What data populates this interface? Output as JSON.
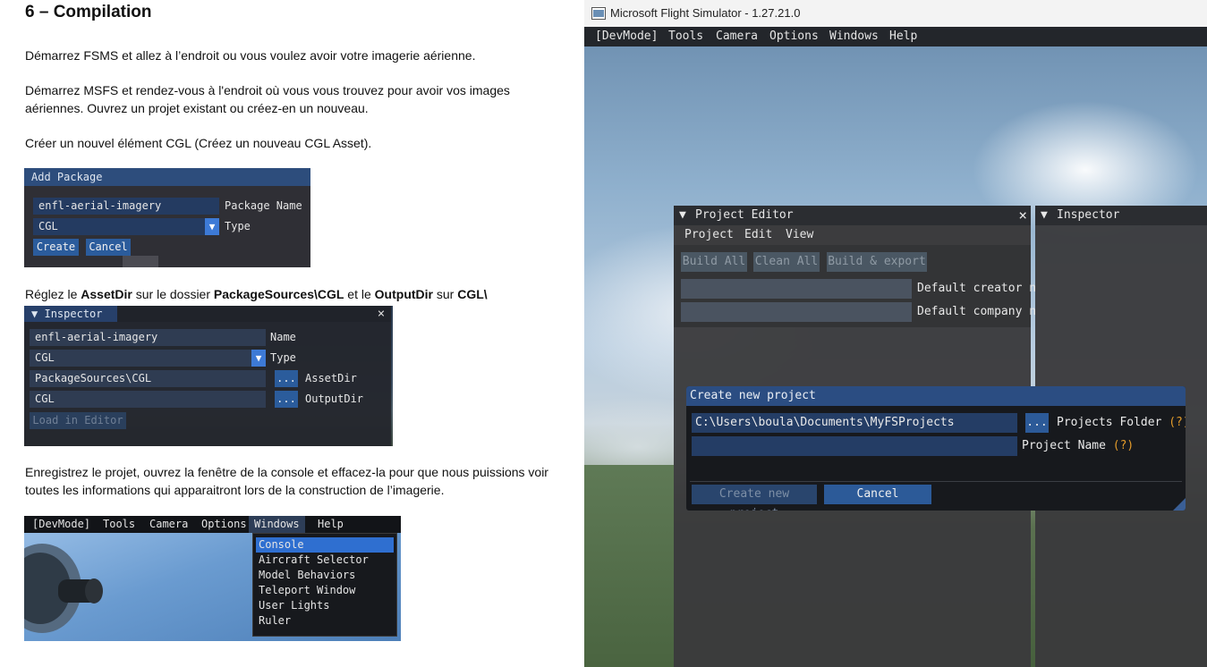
{
  "doc": {
    "heading": "6 – Compilation",
    "para1": "Démarrez FSMS et allez à l’endroit ou vous voulez avoir votre imagerie aérienne.",
    "para2_line1": "Démarrez MSFS et rendez-vous à l'endroit où vous vous trouvez pour avoir vos images",
    "para2_line2": "aériennes. Ouvrez un projet existant ou créez-en un nouveau.",
    "para3": "Créer un nouvel élément CGL (Créez un nouveau CGL Asset).",
    "para4": {
      "t1": "Réglez le ",
      "b1": "AssetDir",
      "t2": " sur le dossier ",
      "b2": "PackageSources\\CGL",
      "t3": " et le ",
      "b3": "OutputDir",
      "t4": " sur ",
      "b4": "CGL\\"
    },
    "para5_line1": "Enregistrez le projet, ouvrez la fenêtre de la console et effacez-la pour que nous puissions voir",
    "para5_line2": "toutes les informations qui apparaitront lors de la construction de l’imagerie."
  },
  "add_package": {
    "title": "Add Package",
    "name_value": "enfl-aerial-imagery",
    "name_label": "Package Name",
    "type_value": "CGL",
    "type_label": "Type",
    "create": "Create",
    "cancel": "Cancel"
  },
  "inspector_shot": {
    "title": "Inspector",
    "close": "×",
    "name_value": "enfl-aerial-imagery",
    "name_label": "Name",
    "type_value": "CGL",
    "type_label": "Type",
    "assetdir_value": "PackageSources\\CGL",
    "assetdir_label": "AssetDir",
    "outputdir_value": "CGL",
    "outputdir_label": "OutputDir",
    "browse": "...",
    "load": "Load in Editor"
  },
  "windows_menu_shot": {
    "menus": [
      "[DevMode]",
      "Tools",
      "Camera",
      "Options",
      "Windows",
      "Help"
    ],
    "items": [
      "Console",
      "Aircraft Selector",
      "Model Behaviors",
      "Teleport Window",
      "User Lights",
      "Ruler"
    ]
  },
  "sim": {
    "window_title": "Microsoft Flight Simulator - 1.27.21.0",
    "menus": [
      "[DevMode]",
      "Tools",
      "Camera",
      "Options",
      "Windows",
      "Help"
    ],
    "project_editor": {
      "title": "Project Editor",
      "close": "×",
      "menus": [
        "Project",
        "Edit",
        "View"
      ],
      "build_all": "Build All",
      "clean_all": "Clean All",
      "build_export": "Build & export",
      "creator_label": "Default creator n",
      "company_label": "Default company n"
    },
    "inspector": {
      "title": "Inspector"
    },
    "dialog": {
      "title": "Create new project",
      "folder_value": "C:\\Users\\boula\\Documents\\MyFSProjects",
      "browse": "...",
      "folder_label": "Projects Folder",
      "help": "(?)",
      "name_label": "Project Name",
      "create": "Create new project",
      "cancel": "Cancel"
    }
  }
}
